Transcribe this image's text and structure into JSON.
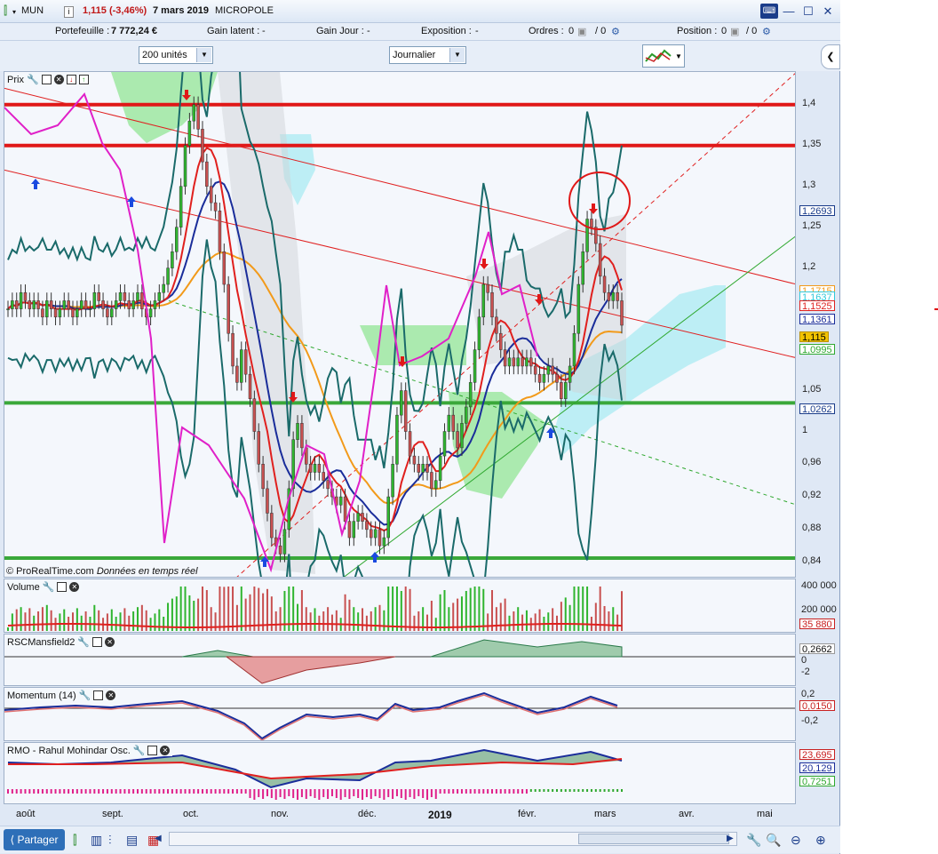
{
  "titlebar": {
    "ticker": "MUN",
    "info": "i",
    "price_change": "1,115 (-3,46%)",
    "date": "7 mars 2019",
    "company": "MICROPOLE"
  },
  "infobar": {
    "portefeuille_label": "Portefeuille :",
    "portefeuille_value": "7 772,24 €",
    "gain_latent_label": "Gain latent :",
    "gain_latent_value": "-",
    "gain_jour_label": "Gain Jour :",
    "gain_jour_value": "-",
    "exposition_label": "Exposition :",
    "exposition_value": "-",
    "ordres_label": "Ordres :",
    "ordres_a": "0",
    "ordres_b": "/ 0",
    "position_label": "Position :",
    "position_a": "0",
    "position_b": "/ 0"
  },
  "toolbar": {
    "units_select": "200 unités",
    "period_select": "Journalier"
  },
  "colors": {
    "price_up": "#2fb52f",
    "price_down": "#c85050",
    "ma_red": "#e0201e",
    "ma_blue": "#1a2d9a",
    "ma_orange": "#f29a1a",
    "boll_teal": "#1a6a6a",
    "mansfield_magenta": "#e020c8",
    "h_red": "#e01818",
    "h_green": "#3aa83a",
    "cloud_green": "#6fe06f",
    "cloud_cyan": "#8fe8ef"
  },
  "price_panel": {
    "title": "Prix",
    "watermark": "© ProRealTime.com",
    "watermark_note": "Données en temps réel",
    "y_ticks": [
      "1,4",
      "1,35",
      "1,3",
      "1,25",
      "1,2",
      "1,15",
      "1,1",
      "1,05",
      "1",
      "0,96",
      "0,92",
      "0,88",
      "0,84"
    ],
    "value_labels": [
      {
        "text": "1,2693",
        "color": "#ffffff",
        "fg": "#1a3c8a"
      },
      {
        "text": "1,1715",
        "color": "#ffffff",
        "fg": "#f29a1a"
      },
      {
        "text": "1,1637",
        "color": "#ffffff",
        "fg": "#30c8d8"
      },
      {
        "text": "1,1525",
        "color": "#ffffff",
        "fg": "#e0201e"
      },
      {
        "text": "1,1361",
        "color": "#ffffff",
        "fg": "#1a2d9a"
      },
      {
        "text": "1,115",
        "color": "#f2c300",
        "fg": "#000000"
      },
      {
        "text": "1,0995",
        "color": "#ffffff",
        "fg": "#2fa82f"
      },
      {
        "text": "1,0262",
        "color": "#ffffff",
        "fg": "#1a3c8a"
      }
    ]
  },
  "volume_panel": {
    "title": "Volume",
    "y_ticks": [
      "400 000",
      "200 000"
    ],
    "value_label": "35 880"
  },
  "rsc_panel": {
    "title": "RSCMansfield2",
    "y_ticks": [
      "0",
      "-2"
    ],
    "value_label": "0,2662"
  },
  "momentum_panel": {
    "title": "Momentum (14)",
    "y_ticks": [
      "0,2",
      "-0,2"
    ],
    "value_label": "0,0150"
  },
  "rmo_panel": {
    "title": "RMO - Rahul Mohindar Osc.",
    "value_labels": [
      "23,695",
      "20,129",
      "0,7251"
    ]
  },
  "x_axis": [
    "août",
    "sept.",
    "oct.",
    "nov.",
    "déc.",
    "2019",
    "févr.",
    "mars",
    "avr.",
    "mai"
  ],
  "bottombar": {
    "share_label": "Partager"
  },
  "chart_data": {
    "type": "candlestick",
    "title": "MUN",
    "x_labels": [
      "août",
      "sept.",
      "oct.",
      "nov.",
      "déc.",
      "2019",
      "févr.",
      "mars",
      "avr.",
      "mai"
    ],
    "ylim": [
      0.82,
      1.44
    ],
    "close_approx": [
      1.15,
      1.16,
      1.15,
      1.17,
      1.16,
      1.15,
      1.16,
      1.15,
      1.14,
      1.16,
      1.15,
      1.14,
      1.15,
      1.16,
      1.15,
      1.14,
      1.15,
      1.16,
      1.15,
      1.15,
      1.17,
      1.16,
      1.15,
      1.14,
      1.15,
      1.16,
      1.17,
      1.16,
      1.15,
      1.16,
      1.17,
      1.15,
      1.14,
      1.15,
      1.16,
      1.17,
      1.18,
      1.2,
      1.22,
      1.25,
      1.3,
      1.35,
      1.38,
      1.4,
      1.37,
      1.33,
      1.3,
      1.28,
      1.27,
      1.22,
      1.18,
      1.12,
      1.08,
      1.06,
      1.1,
      1.07,
      1.04,
      1.0,
      0.96,
      0.93,
      0.9,
      0.87,
      0.86,
      0.85,
      0.88,
      0.93,
      0.99,
      1.01,
      0.98,
      0.96,
      0.95,
      0.96,
      0.95,
      0.94,
      0.93,
      0.92,
      0.91,
      0.92,
      0.89,
      0.87,
      0.89,
      0.9,
      0.89,
      0.88,
      0.87,
      0.88,
      0.86,
      0.87,
      0.92,
      0.96,
      1.02,
      1.05,
      1.0,
      0.97,
      0.96,
      0.95,
      0.96,
      0.95,
      0.93,
      0.94,
      0.97,
      1.0,
      1.02,
      1.0,
      0.98,
      1.01,
      1.03,
      1.06,
      1.1,
      1.14,
      1.18,
      1.17,
      1.14,
      1.12,
      1.1,
      1.08,
      1.09,
      1.08,
      1.09,
      1.08,
      1.09,
      1.08,
      1.07,
      1.06,
      1.07,
      1.08,
      1.07,
      1.06,
      1.04,
      1.06,
      1.08,
      1.12,
      1.18,
      1.22,
      1.26,
      1.25,
      1.23,
      1.19,
      1.17,
      1.16,
      1.17,
      1.16,
      1.13
    ],
    "horizontal_lines": [
      {
        "value": 1.4,
        "color": "red"
      },
      {
        "value": 1.35,
        "color": "red"
      },
      {
        "value": 1.035,
        "color": "green"
      },
      {
        "value": 0.845,
        "color": "green"
      }
    ],
    "last": 1.115,
    "indicators": {
      "ma_red": 1.1525,
      "ma_blue": 1.1361,
      "ma_orange": 1.1715,
      "boll_upper": 1.2693,
      "boll_lower": 1.0262,
      "ichimoku_cyan": 1.1637,
      "green_line": 1.0995
    }
  }
}
